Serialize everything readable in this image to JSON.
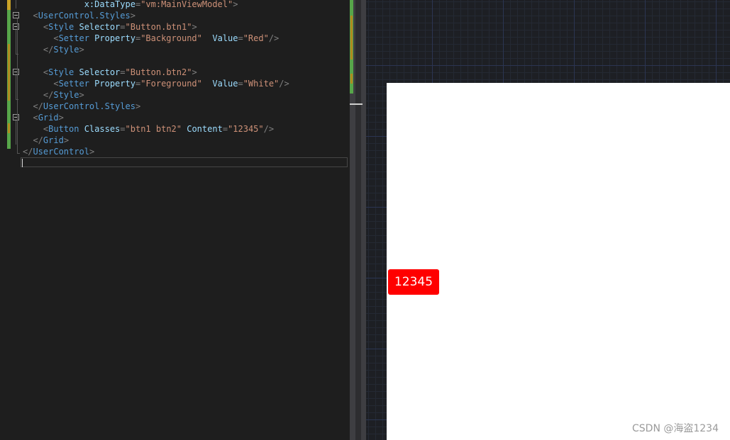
{
  "editor": {
    "lines": [
      [
        [
          "p",
          "            "
        ],
        [
          "a",
          "x:DataType"
        ],
        [
          "p",
          "="
        ],
        [
          "v",
          "\"vm:MainViewModel\""
        ],
        [
          "p",
          ">"
        ]
      ],
      [
        [
          "p",
          "  <"
        ],
        [
          "t",
          "UserControl.Styles"
        ],
        [
          "p",
          ">"
        ]
      ],
      [
        [
          "p",
          "    <"
        ],
        [
          "t",
          "Style "
        ],
        [
          "a",
          "Selector"
        ],
        [
          "p",
          "="
        ],
        [
          "v",
          "\"Button.btn1\""
        ],
        [
          "p",
          ">"
        ]
      ],
      [
        [
          "p",
          "      <"
        ],
        [
          "t",
          "Setter "
        ],
        [
          "a",
          "Property"
        ],
        [
          "p",
          "="
        ],
        [
          "v",
          "\"Background\""
        ],
        [
          "p",
          "  "
        ],
        [
          "a",
          "Value"
        ],
        [
          "p",
          "="
        ],
        [
          "v",
          "\"Red\""
        ],
        [
          "p",
          "/>"
        ]
      ],
      [
        [
          "p",
          "    </"
        ],
        [
          "t",
          "Style"
        ],
        [
          "p",
          ">"
        ]
      ],
      [],
      [
        [
          "p",
          "    <"
        ],
        [
          "t",
          "Style "
        ],
        [
          "a",
          "Selector"
        ],
        [
          "p",
          "="
        ],
        [
          "v",
          "\"Button.btn2\""
        ],
        [
          "p",
          ">"
        ]
      ],
      [
        [
          "p",
          "      <"
        ],
        [
          "t",
          "Setter "
        ],
        [
          "a",
          "Property"
        ],
        [
          "p",
          "="
        ],
        [
          "v",
          "\"Foreground\""
        ],
        [
          "p",
          "  "
        ],
        [
          "a",
          "Value"
        ],
        [
          "p",
          "="
        ],
        [
          "v",
          "\"White\""
        ],
        [
          "p",
          "/>"
        ]
      ],
      [
        [
          "p",
          "    </"
        ],
        [
          "t",
          "Style"
        ],
        [
          "p",
          ">"
        ]
      ],
      [
        [
          "p",
          "  </"
        ],
        [
          "t",
          "UserControl.Styles"
        ],
        [
          "p",
          ">"
        ]
      ],
      [
        [
          "p",
          "  <"
        ],
        [
          "t",
          "Grid"
        ],
        [
          "p",
          ">"
        ]
      ],
      [
        [
          "p",
          "    <"
        ],
        [
          "t",
          "Button "
        ],
        [
          "a",
          "Classes"
        ],
        [
          "p",
          "="
        ],
        [
          "v",
          "\"btn1 btn2\""
        ],
        [
          "p",
          " "
        ],
        [
          "a",
          "Content"
        ],
        [
          "p",
          "="
        ],
        [
          "v",
          "\"12345\""
        ],
        [
          "p",
          "/>"
        ]
      ],
      [
        [
          "p",
          "  </"
        ],
        [
          "t",
          "Grid"
        ],
        [
          "p",
          ">"
        ]
      ],
      [
        [
          "p",
          "</"
        ],
        [
          "t",
          "UserControl"
        ],
        [
          "p",
          ">"
        ]
      ]
    ]
  },
  "preview": {
    "button_label": "12345",
    "button_background": "#ff0000",
    "button_foreground": "#ffffff"
  },
  "watermark": "CSDN @海盗1234"
}
